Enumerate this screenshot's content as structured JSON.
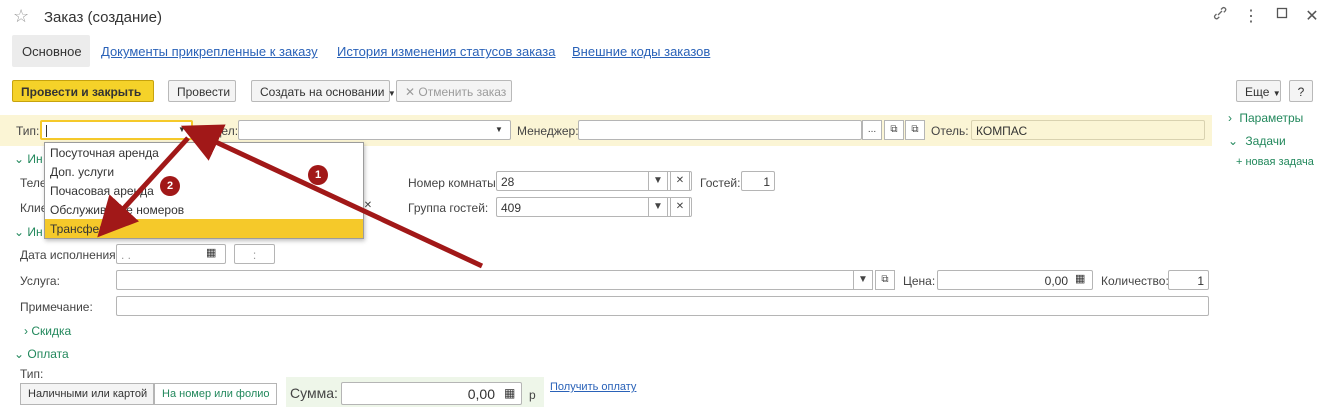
{
  "window": {
    "title": "Заказ (создание)",
    "controls": [
      "link-icon",
      "more-icon",
      "maximize-icon",
      "close-icon"
    ]
  },
  "tabs": [
    {
      "label": "Основное",
      "active": true
    },
    {
      "label": "Документы прикрепленные к заказу",
      "active": false
    },
    {
      "label": "История изменения статусов заказа",
      "active": false
    },
    {
      "label": "Внешние коды заказов",
      "active": false
    }
  ],
  "toolbar": {
    "post_close": "Провести и закрыть",
    "post": "Провести",
    "create_based": "Создать на основании",
    "cancel_order": "Отменить заказ",
    "more": "Еще",
    "help": "?"
  },
  "header": {
    "type_label": "Тип:",
    "type_value": "",
    "dept_label": "Отдел:",
    "dept_value": "",
    "manager_label": "Менеджер:",
    "manager_value": "",
    "hotel_label": "Отель:",
    "hotel_value": "КОМПАС"
  },
  "dropdown": {
    "items": [
      "Посуточная аренда",
      "Доп. услуги",
      "Почасовая аренда",
      "Обслуживание номеров",
      "Трансфер"
    ],
    "selected_index": 4
  },
  "annotations": {
    "badge1": "1",
    "badge2": "2"
  },
  "group1": {
    "title": "Ин",
    "phone_label": "Теле",
    "client_label": "Клие",
    "room_label": "Номер комнаты:",
    "room_value": "28",
    "guests_label": "Гостей:",
    "guests_value": "1",
    "guest_group_label": "Группа гостей:",
    "guest_group_value": "409"
  },
  "group2": {
    "title": "Ин",
    "date_label": "Дата исполнения:",
    "date_value": ". .",
    "time_value": ":",
    "service_label": "Услуга:",
    "service_value": "",
    "price_label": "Цена:",
    "price_value": "0,00",
    "qty_label": "Количество:",
    "qty_value": "1",
    "note_label": "Примечание:",
    "note_value": ""
  },
  "discount": {
    "title": "Скидка"
  },
  "payment": {
    "title": "Оплата",
    "type_label": "Тип:",
    "cash_card": "Наличными или картой",
    "room_folio": "На номер или фолио",
    "sum_label": "Сумма:",
    "sum_value": "0,00",
    "currency": "р",
    "get_payment": "Получить оплату"
  },
  "sidebar": {
    "params": "Параметры",
    "tasks": "Задачи",
    "new_task": "+ новая задача"
  },
  "colors": {
    "accent_yellow": "#f5d229",
    "green": "#22885c",
    "link_blue": "#2a62b8",
    "arrow_red": "#a11818"
  }
}
